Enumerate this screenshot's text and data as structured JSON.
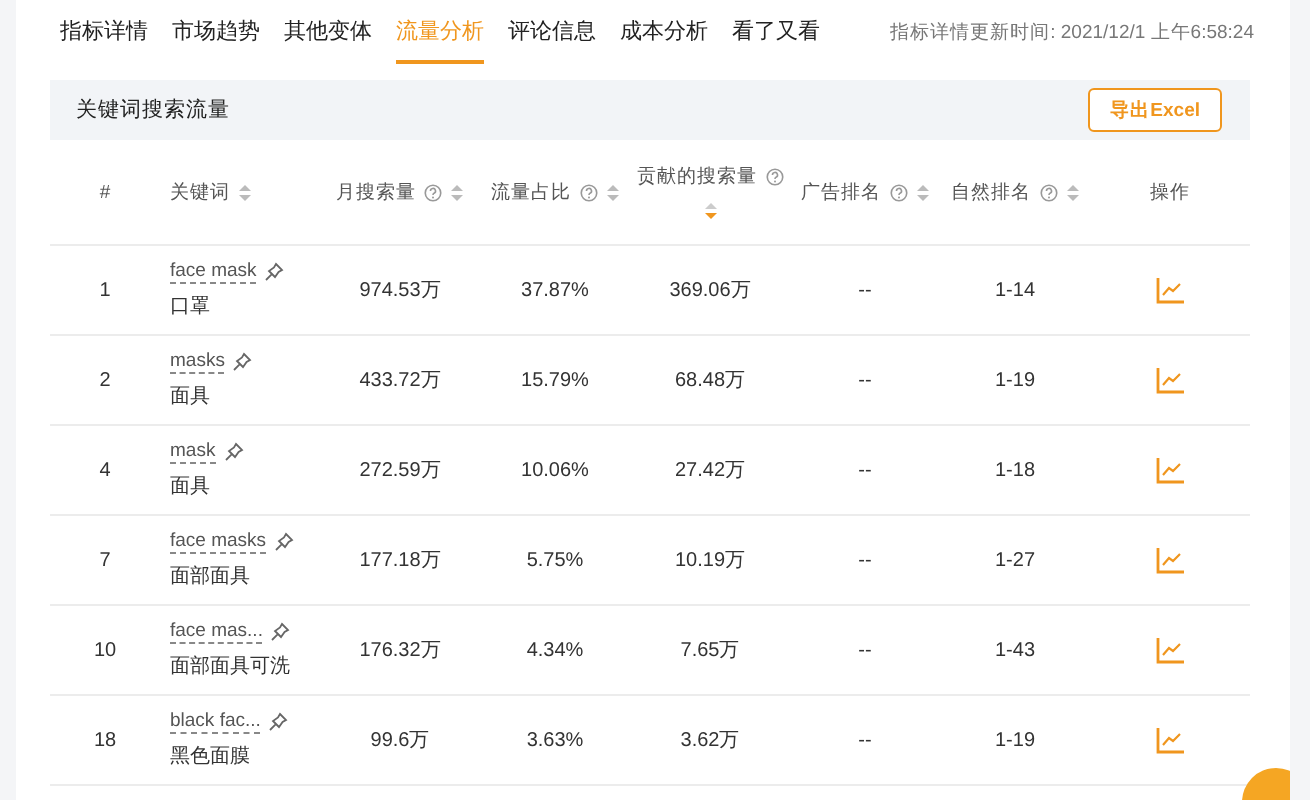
{
  "tabs": [
    {
      "label": "指标详情",
      "selected": false
    },
    {
      "label": "市场趋势",
      "selected": false
    },
    {
      "label": "其他变体",
      "selected": false
    },
    {
      "label": "流量分析",
      "selected": true
    },
    {
      "label": "评论信息",
      "selected": false
    },
    {
      "label": "成本分析",
      "selected": false
    },
    {
      "label": "看了又看",
      "selected": false
    }
  ],
  "updated": "指标详情更新时间: 2021/12/1 上午6:58:24",
  "panel": {
    "title": "关键词搜索流量",
    "export_button": "导出Excel"
  },
  "table": {
    "columns": [
      {
        "label": "#",
        "help": false,
        "sortable": false
      },
      {
        "label": "关键词",
        "help": false,
        "sortable": true,
        "sorted_desc": false
      },
      {
        "label": "月搜索量",
        "help": true,
        "sortable": true,
        "sorted_desc": false
      },
      {
        "label": "流量占比",
        "help": true,
        "sortable": true,
        "sorted_desc": false
      },
      {
        "label": "贡献的搜索量",
        "help": true,
        "sortable": true,
        "sorted_desc": true
      },
      {
        "label": "广告排名",
        "help": true,
        "sortable": true,
        "sorted_desc": false
      },
      {
        "label": "自然排名",
        "help": true,
        "sortable": true,
        "sorted_desc": false
      },
      {
        "label": "操作",
        "help": false,
        "sortable": false
      }
    ],
    "rows": [
      {
        "rank": "1",
        "keyword": "face mask",
        "translation": "口罩",
        "monthly": "974.53万",
        "share": "37.87%",
        "contributed": "369.06万",
        "ad_rank": "--",
        "natural_rank": "1-14"
      },
      {
        "rank": "2",
        "keyword": "masks",
        "translation": "面具",
        "monthly": "433.72万",
        "share": "15.79%",
        "contributed": "68.48万",
        "ad_rank": "--",
        "natural_rank": "1-19"
      },
      {
        "rank": "4",
        "keyword": "mask",
        "translation": "面具",
        "monthly": "272.59万",
        "share": "10.06%",
        "contributed": "27.42万",
        "ad_rank": "--",
        "natural_rank": "1-18"
      },
      {
        "rank": "7",
        "keyword": "face masks",
        "translation": "面部面具",
        "monthly": "177.18万",
        "share": "5.75%",
        "contributed": "10.19万",
        "ad_rank": "--",
        "natural_rank": "1-27"
      },
      {
        "rank": "10",
        "keyword": "face mas...",
        "translation": "面部面具可洗",
        "monthly": "176.32万",
        "share": "4.34%",
        "contributed": "7.65万",
        "ad_rank": "--",
        "natural_rank": "1-43"
      },
      {
        "rank": "18",
        "keyword": "black fac...",
        "translation": "黑色面膜",
        "monthly": "99.6万",
        "share": "3.63%",
        "contributed": "3.62万",
        "ad_rank": "--",
        "natural_rank": "1-19"
      }
    ]
  }
}
